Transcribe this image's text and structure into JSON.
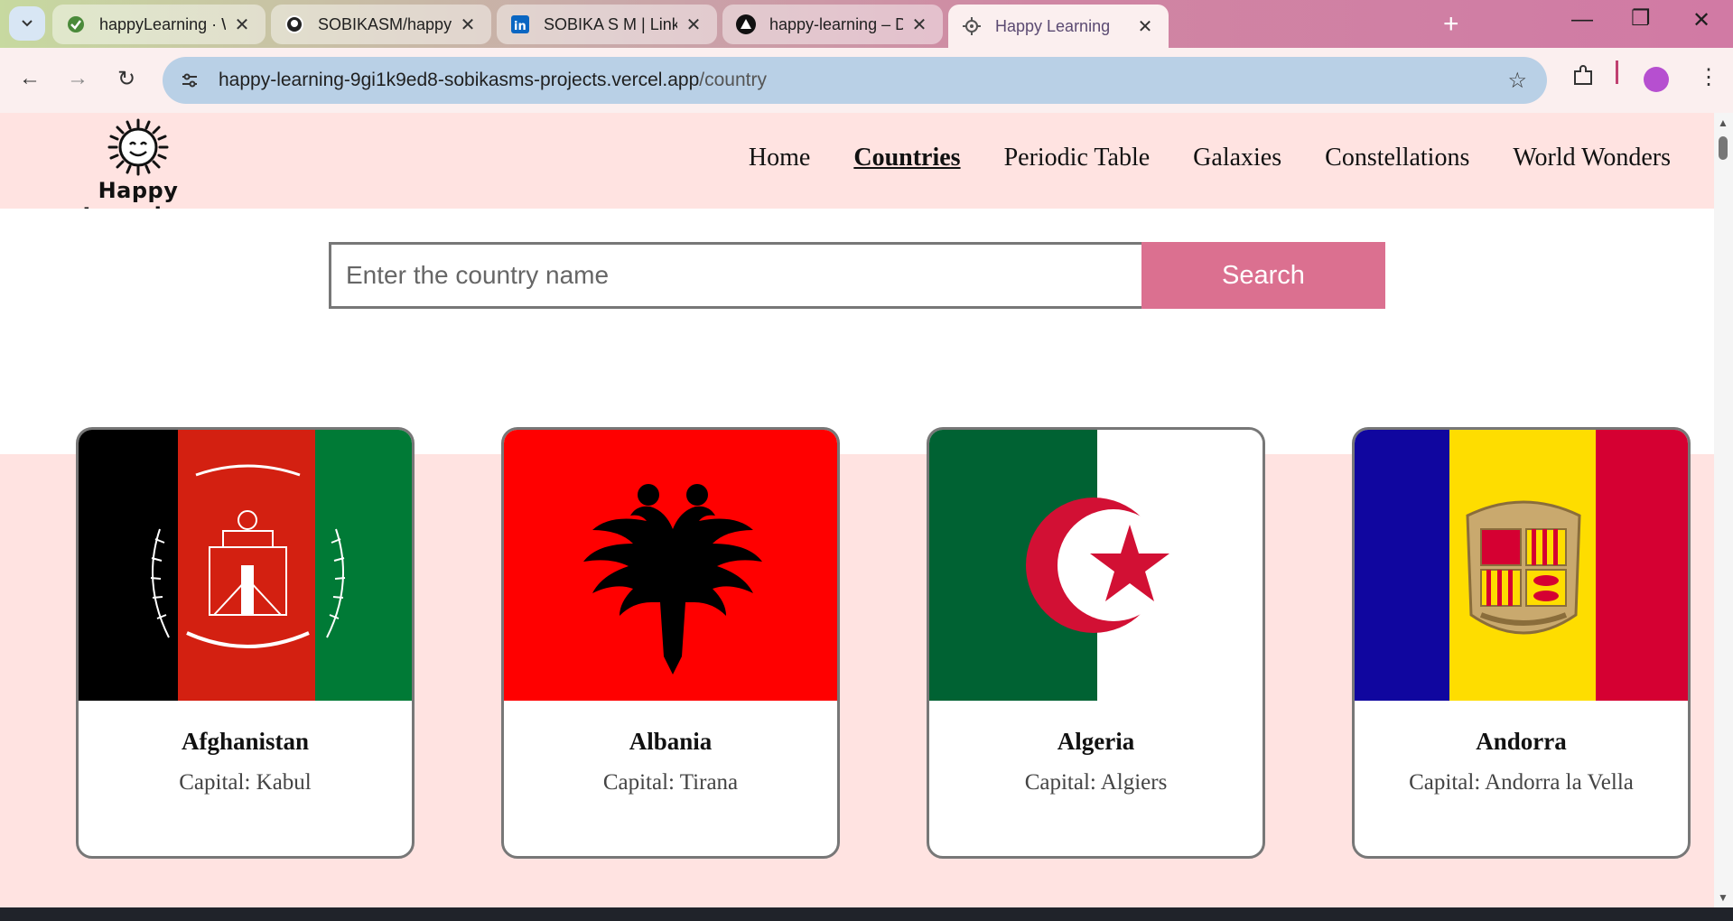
{
  "browser": {
    "tabs": [
      {
        "title": "happyLearning · Web Se",
        "icon": "render-check-icon"
      },
      {
        "title": "SOBIKASM/happyLearnin",
        "icon": "github-icon"
      },
      {
        "title": "SOBIKA S M | LinkedIn",
        "icon": "linkedin-icon"
      },
      {
        "title": "happy-learning – Deploy",
        "icon": "vercel-icon"
      },
      {
        "title": "Happy Learning",
        "icon": "gear-icon"
      }
    ],
    "url_host": "happy-learning-9gi1k9ed8-sobikasms-projects.vercel.app",
    "url_path": "/country"
  },
  "site": {
    "brand": "Happy Learning",
    "nav": [
      "Home",
      "Countries",
      "Periodic Table",
      "Galaxies",
      "Constellations",
      "World Wonders"
    ],
    "active_nav": "Countries"
  },
  "search": {
    "placeholder": "Enter the country name",
    "button": "Search"
  },
  "countries": [
    {
      "name": "Afghanistan",
      "capital": "Capital: Kabul",
      "colors": [
        "#000000",
        "#d32011",
        "#007a36"
      ]
    },
    {
      "name": "Albania",
      "capital": "Capital: Tirana",
      "colors": [
        "#ff0000",
        "#000000"
      ]
    },
    {
      "name": "Algeria",
      "capital": "Capital: Algiers",
      "colors": [
        "#006233",
        "#ffffff",
        "#d21034"
      ]
    },
    {
      "name": "Andorra",
      "capital": "Capital: Andorra la Vella",
      "colors": [
        "#10069f",
        "#fedd00",
        "#d50032"
      ]
    }
  ]
}
